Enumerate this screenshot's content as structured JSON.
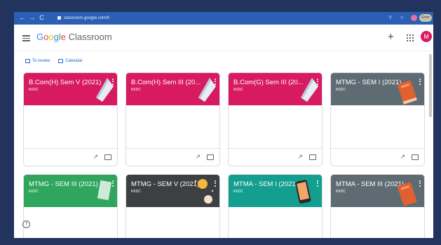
{
  "browser": {
    "url": "classroom.google.com/h",
    "nav": [
      "←",
      "→",
      "C"
    ],
    "error_label": "Error"
  },
  "header": {
    "logo_parts": [
      "G",
      "o",
      "o",
      "g",
      "l",
      "e"
    ],
    "app_name": "Classroom",
    "plus": "+",
    "account_initial": "M"
  },
  "subnav": {
    "to_review": "To review",
    "calendar": "Calendar"
  },
  "colors": {
    "pink": "#d81b60",
    "grey": "#5f6b73",
    "green": "#2fa55e",
    "dark": "#3c4043",
    "teal": "#139e8f"
  },
  "cards": [
    {
      "title": "B.Com(H) Sem V (2021)",
      "section": "KKDC",
      "color": "#d81b60",
      "icon": "paper-icon"
    },
    {
      "title": "B.Com(H) Sem III (20...",
      "section": "KKDC",
      "color": "#d81b60",
      "icon": "paper-icon"
    },
    {
      "title": "B.Com(G) Sem III (20...",
      "section": "KKDC",
      "color": "#d81b60",
      "icon": "paper-icon"
    },
    {
      "title": "MTMG - SEM I (2021)",
      "section": "KKDC",
      "color": "#5f6b73",
      "icon": "book-icon"
    },
    {
      "title": "MTMG - SEM III (2021)",
      "section": "KKDC",
      "color": "#2fa55e",
      "icon": "paper-icon"
    },
    {
      "title": "MTMG - SEM V (2021)",
      "section": "KKDC",
      "color": "#3c4043",
      "icon": "lightbulb-icon"
    },
    {
      "title": "MTMA - SEM I (2021)",
      "section": "KKDC",
      "color": "#139e8f",
      "icon": "tablet-icon"
    },
    {
      "title": "MTMA - SEM III (2021)",
      "section": "KKDC",
      "color": "#5f6b73",
      "icon": "book-icon"
    }
  ],
  "card_footer": {
    "trend_icon": "↗",
    "folder_icon": "folder-icon"
  },
  "help": "?"
}
